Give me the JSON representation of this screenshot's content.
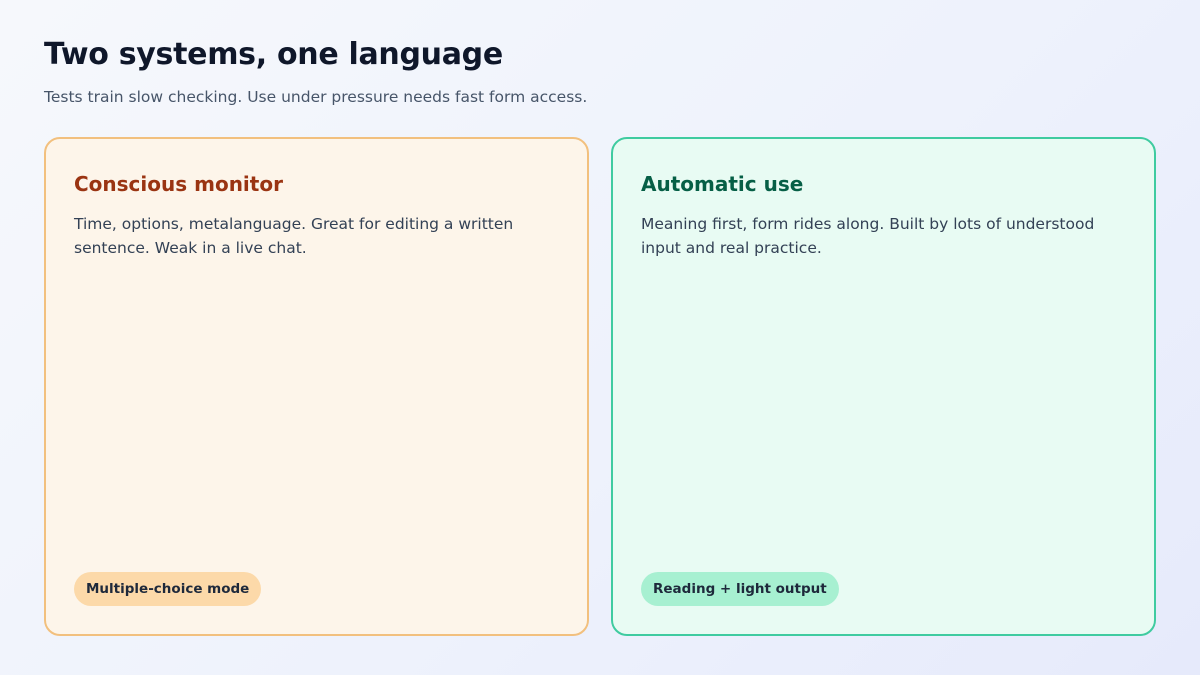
{
  "header": {
    "title": "Two systems, one language",
    "subtitle": "Tests train slow checking. Use under pressure needs fast form access."
  },
  "cards": [
    {
      "title": "Conscious monitor",
      "body": "Time, options, metalanguage. Great for editing a written sentence. Weak in a live chat.",
      "badge": "Multiple-choice mode",
      "accent_color": "#9a3412",
      "background_color": "#fdf5ea",
      "border_color": "#f2c07e",
      "badge_color": "#fcd9a9"
    },
    {
      "title": "Automatic use",
      "body": "Meaning first, form rides along. Built by lots of understood input and real practice.",
      "badge": "Reading + light output",
      "accent_color": "#065f46",
      "background_color": "#e8fbf3",
      "border_color": "#3fcba0",
      "badge_color": "#a7f0d1"
    }
  ]
}
